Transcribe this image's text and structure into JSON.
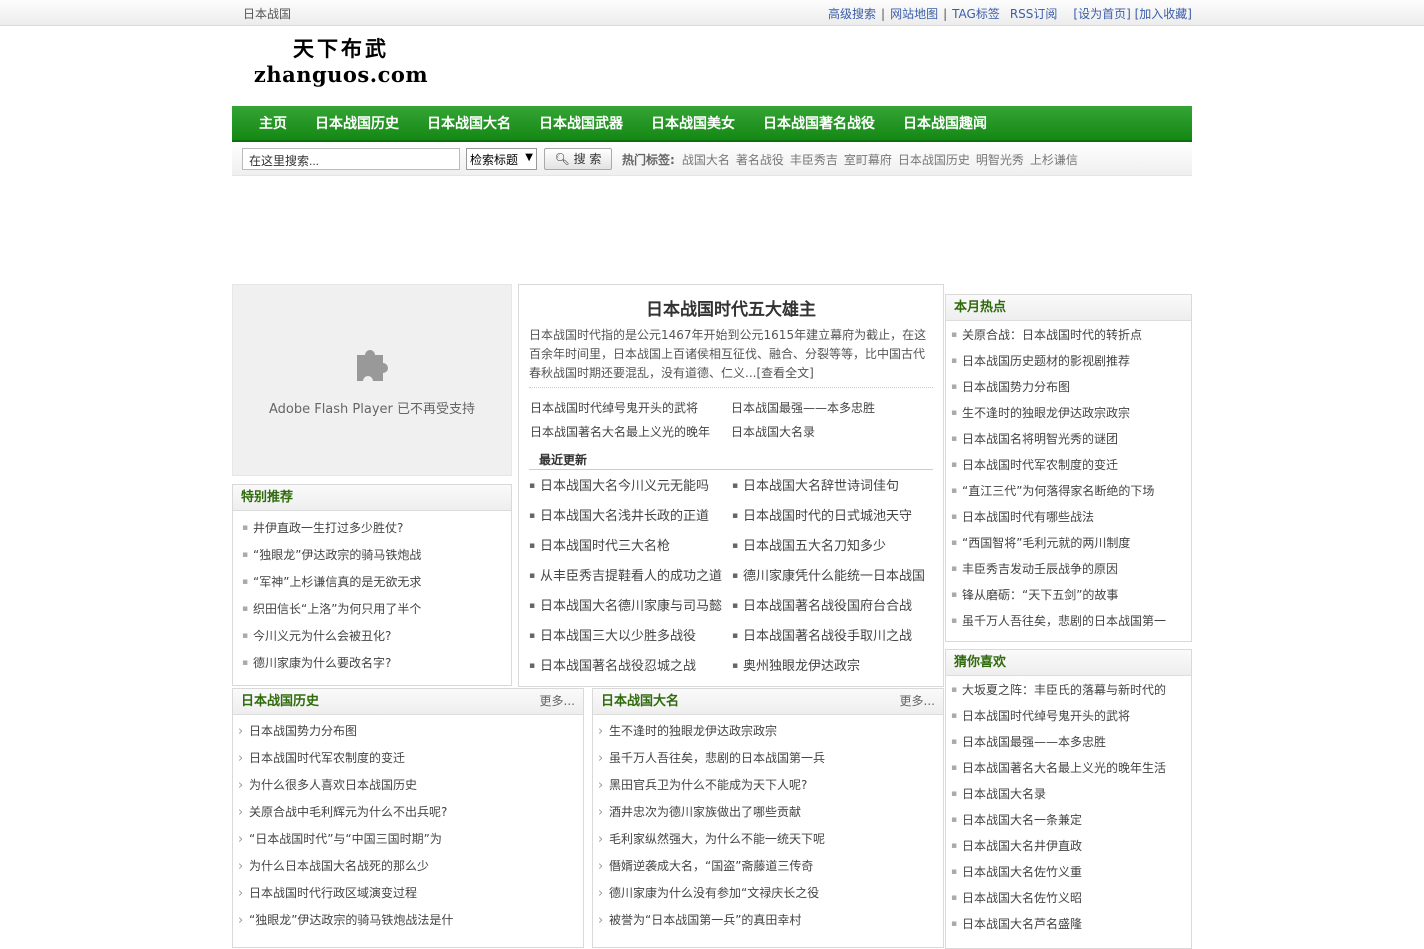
{
  "topbar": {
    "site_name": "日本战国",
    "links": [
      "高级搜索",
      "网站地图",
      "TAG标签",
      "RSS订阅"
    ],
    "set_home": "[设为首页]",
    "bookmark": "[加入收藏]"
  },
  "logo": {
    "line1": "天下布武",
    "line2": "zhanguos.com"
  },
  "nav": [
    "主页",
    "日本战国历史",
    "日本战国大名",
    "日本战国武器",
    "日本战国美女",
    "日本战国著名战役",
    "日本战国趣闻"
  ],
  "search": {
    "placeholder": "在这里搜索...",
    "select": "检索标题",
    "button": "搜 索",
    "hot_label": "热门标签:",
    "hot_tags": [
      "战国大名",
      "著名战役",
      "丰臣秀吉",
      "室町幕府",
      "日本战国历史",
      "明智光秀",
      "上杉谦信"
    ]
  },
  "flash": {
    "text": "Adobe Flash Player 已不再受支持"
  },
  "featured": {
    "title": "日本战国时代五大雄主",
    "intro": "日本战国时代指的是公元1467年开始到公元1615年建立幕府为截止，在这百余年时间里，日本战国上百诸侯相互征伐、融合、分裂等等，比中国古代春秋战国时期还要混乱，没有道德、仁义...[查看全文]",
    "links": [
      "日本战国时代绰号鬼开头的武将",
      "日本战国最强——本多忠胜",
      "日本战国著名大名最上义光的晚年",
      "日本战国大名录"
    ]
  },
  "recent": {
    "title": "最近更新",
    "items": [
      "日本战国大名今川义元无能吗",
      "日本战国大名辞世诗词佳句",
      "日本战国大名浅井长政的正道",
      "日本战国时代的日式城池天守",
      "日本战国时代三大名枪",
      "日本战国五大名刀知多少",
      "从丰臣秀吉提鞋看人的成功之道",
      "德川家康凭什么能统一日本战国",
      "日本战国大名德川家康与司马懿",
      "日本战国著名战役国府台合战",
      "日本战国三大以少胜多战役",
      "日本战国著名战役手取川之战",
      "日本战国著名战役忍城之战",
      "奥州独眼龙伊达政宗"
    ]
  },
  "special": {
    "title": "特别推荐",
    "items": [
      "井伊直政一生打过多少胜仗?",
      "“独眼龙”伊达政宗的骑马铁炮战",
      "“军神”上杉谦信真的是无欲无求",
      "织田信长“上洛”为何只用了半个",
      "今川义元为什么会被丑化?",
      "德川家康为什么要改名字?"
    ]
  },
  "hot_month": {
    "title": "本月热点",
    "items": [
      "关原合战：日本战国时代的转折点",
      "日本战国历史题材的影视剧推荐",
      "日本战国势力分布图",
      "生不逢时的独眼龙伊达政宗政宗",
      "日本战国名将明智光秀的谜团",
      "日本战国时代军农制度的变迁",
      "“直江三代”为何落得家名断绝的下场",
      "日本战国时代有哪些战法",
      "“西国智将”毛利元就的两川制度",
      "丰臣秀吉发动壬辰战争的原因",
      "锋从磨砺：“天下五剑”的故事",
      "虽千万人吾往矣，悲剧的日本战国第一"
    ]
  },
  "guess": {
    "title": "猜你喜欢",
    "items": [
      "大坂夏之阵：丰臣氏的落幕与新时代的",
      "日本战国时代绰号鬼开头的武将",
      "日本战国最强——本多忠胜",
      "日本战国著名大名最上义光的晚年生活",
      "日本战国大名录",
      "日本战国大名一条兼定",
      "日本战国大名井伊直政",
      "日本战国大名佐竹义重",
      "日本战国大名佐竹义昭",
      "日本战国大名芦名盛隆"
    ]
  },
  "history": {
    "title": "日本战国历史",
    "more": "更多...",
    "items": [
      "日本战国势力分布图",
      "日本战国时代军农制度的变迁",
      "为什么很多人喜欢日本战国历史",
      "关原合战中毛利辉元为什么不出兵呢?",
      "“日本战国时代”与“中国三国时期”为",
      "为什么日本战国大名战死的那么少",
      "日本战国时代行政区域演变过程",
      "“独眼龙”伊达政宗的骑马铁炮战法是什"
    ]
  },
  "daimyo": {
    "title": "日本战国大名",
    "more": "更多...",
    "items": [
      "生不逢时的独眼龙伊达政宗政宗",
      "虽千万人吾往矣，悲剧的日本战国第一兵",
      "黑田官兵卫为什么不能成为天下人呢?",
      "酒井忠次为德川家族做出了哪些贡献",
      "毛利家纵然强大，为什么不能一统天下呢",
      "僭婿逆袭成大名，“国盗”斋藤道三传奇",
      "德川家康为什么没有参加“文禄庆长之役",
      "被誉为“日本战国第一兵”的真田幸村"
    ]
  }
}
